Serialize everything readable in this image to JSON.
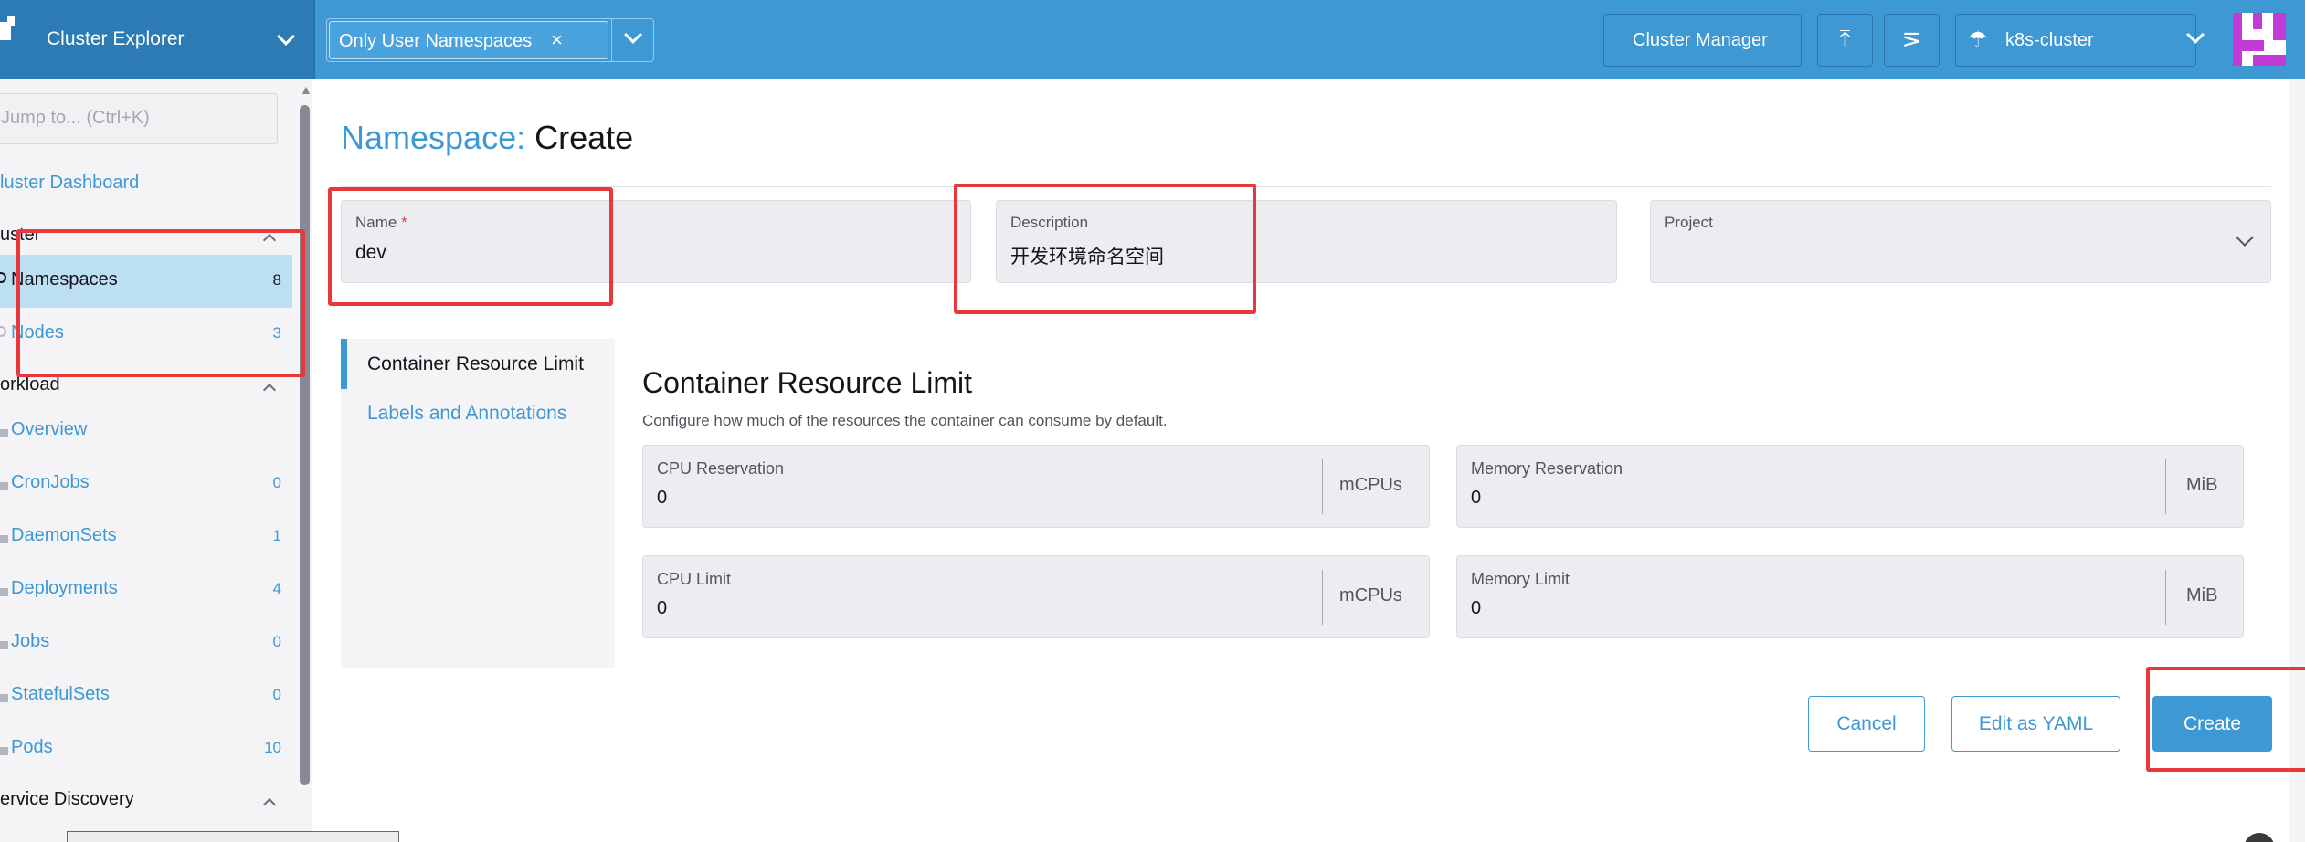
{
  "header": {
    "explorer_title": "Cluster Explorer",
    "namespace_filter": "Only User Namespaces",
    "namespace_filter_remove": "×",
    "cluster_manager": "Cluster Manager",
    "upload_icon": "⤒",
    "shell_icon": "⋝",
    "cluster_icon": "☂",
    "cluster_name": "k8s-cluster"
  },
  "sidebar": {
    "jump_placeholder": "Jump to... (Ctrl+K)",
    "dashboard": "luster Dashboard",
    "groups": {
      "cluster": "uster",
      "workload": "orkload",
      "service_discovery": "ervice Discovery"
    },
    "items": {
      "namespaces": {
        "label": "Namespaces",
        "count": "8"
      },
      "nodes": {
        "label": "Nodes",
        "count": "3"
      },
      "overview": {
        "label": "Overview"
      },
      "cronjobs": {
        "label": "CronJobs",
        "count": "0"
      },
      "daemonsets": {
        "label": "DaemonSets",
        "count": "1"
      },
      "deployments": {
        "label": "Deployments",
        "count": "4"
      },
      "jobs": {
        "label": "Jobs",
        "count": "0"
      },
      "statefulsets": {
        "label": "StatefulSets",
        "count": "0"
      },
      "pods": {
        "label": "Pods",
        "count": "10"
      }
    }
  },
  "page": {
    "title_label": "Namespace:",
    "title_value": "Create"
  },
  "form": {
    "name_label": "Name",
    "name_required": "*",
    "name_value": "dev",
    "description_label": "Description",
    "description_value": "开发环境命名空间",
    "project_label": "Project"
  },
  "tabs": {
    "resource_limit": "Container Resource Limit",
    "labels": "Labels and Annotations"
  },
  "resource_section": {
    "title": "Container Resource Limit",
    "description": "Configure how much of the resources the container can consume by default.",
    "cpu_reservation": {
      "label": "CPU Reservation",
      "value": "0",
      "unit": "mCPUs"
    },
    "memory_reservation": {
      "label": "Memory Reservation",
      "value": "0",
      "unit": "MiB"
    },
    "cpu_limit": {
      "label": "CPU Limit",
      "value": "0",
      "unit": "mCPUs"
    },
    "memory_limit": {
      "label": "Memory Limit",
      "value": "0",
      "unit": "MiB"
    }
  },
  "actions": {
    "cancel": "Cancel",
    "edit_yaml": "Edit as YAML",
    "create": "Create"
  },
  "colors": {
    "brand": "#3d98d3",
    "header_dark": "#2d7bb4",
    "highlight": "#e8383b",
    "active_nav": "#bddff4"
  }
}
